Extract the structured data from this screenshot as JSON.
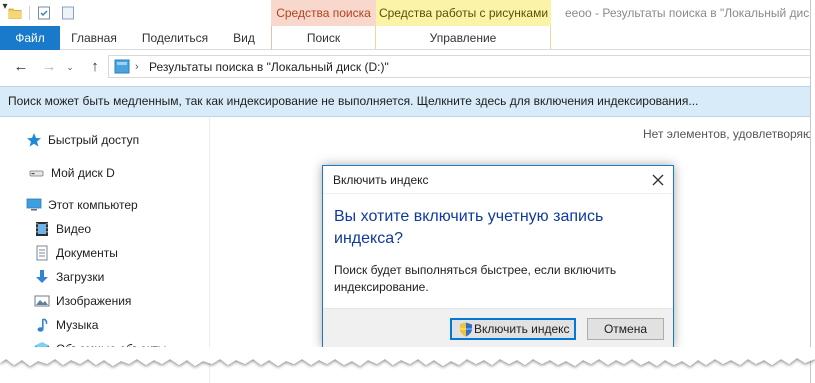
{
  "window": {
    "title": "eeoo - Результаты поиска в \"Локальный диск"
  },
  "context_groups": {
    "search": "Средства поиска",
    "picture": "Средства работы с рисунками"
  },
  "ribbon": {
    "tabs": {
      "file": "Файл",
      "home": "Главная",
      "share": "Поделиться",
      "view": "Вид",
      "search": "Поиск",
      "manage": "Управление"
    },
    "active_tab": "file",
    "colors": {
      "file_tab": "#1979ca",
      "search_group": "#f8d7cc",
      "picture_group": "#fbf4a8"
    }
  },
  "address": {
    "path": "Результаты поиска в \"Локальный диск (D:)\""
  },
  "infobar": {
    "text": "Поиск может быть медленным, так как индексирование не выполняется. Щелкните здесь для включения индексирования..."
  },
  "navpane": {
    "items": [
      {
        "label": "Быстрый доступ",
        "icon": "star-icon"
      },
      {
        "label": "Мой диск D",
        "icon": "drive-icon"
      },
      {
        "label": "Этот компьютер",
        "icon": "computer-icon"
      },
      {
        "label": "Видео",
        "icon": "video-icon"
      },
      {
        "label": "Документы",
        "icon": "documents-icon"
      },
      {
        "label": "Загрузки",
        "icon": "downloads-icon"
      },
      {
        "label": "Изображения",
        "icon": "pictures-icon"
      },
      {
        "label": "Музыка",
        "icon": "music-icon"
      },
      {
        "label": "Объемные объекты",
        "icon": "3d-objects-icon"
      }
    ]
  },
  "content": {
    "empty_text": "Нет элементов, удовлетворяю"
  },
  "dialog": {
    "title": "Включить индекс",
    "heading": "Вы хотите включить учетную запись индекса?",
    "message": "Поиск будет выполняться быстрее, если включить индексирование.",
    "confirm_label": "Включить индекс",
    "cancel_label": "Отмена",
    "accent_color": "#1979ca",
    "heading_color": "#0f3a9e"
  }
}
